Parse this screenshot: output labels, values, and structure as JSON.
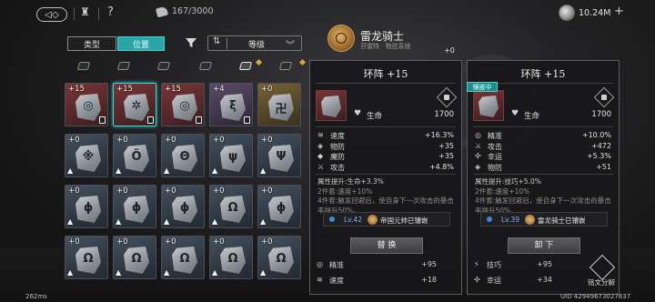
{
  "topbar": {
    "back_glyph": "◁◇",
    "help": "?",
    "bag_count": "167/3000",
    "currency": "10.24M",
    "plus": "+"
  },
  "filters": {
    "tab_type": "类型",
    "tab_position": "位置",
    "sort_label": "等级",
    "sort_arrows": "⇅",
    "chevron": "︾"
  },
  "hero": {
    "name": "雷龙骑士",
    "subtitle": "芬雷特 · 物控系统",
    "badge": "+0"
  },
  "grid": {
    "rows": [
      [
        {
          "lvl": "+15",
          "tone": "red",
          "glyph": "◎",
          "lock": true,
          "up": false
        },
        {
          "lvl": "+15",
          "tone": "red",
          "glyph": "✲",
          "lock": true,
          "up": false,
          "selected": true
        },
        {
          "lvl": "+15",
          "tone": "red",
          "glyph": "◎",
          "lock": true,
          "up": false
        },
        {
          "lvl": "+4",
          "tone": "purple",
          "glyph": "ξ",
          "lock": true,
          "up": false
        },
        {
          "lvl": "+0",
          "tone": "gold",
          "glyph": "卍",
          "lock": false,
          "up": false
        }
      ],
      [
        {
          "lvl": "+0",
          "tone": "blue",
          "glyph": "※",
          "lock": false,
          "up": true
        },
        {
          "lvl": "+0",
          "tone": "blue",
          "glyph": "Ö",
          "lock": false,
          "up": true
        },
        {
          "lvl": "+0",
          "tone": "blue",
          "glyph": "Θ",
          "lock": false,
          "up": true
        },
        {
          "lvl": "+0",
          "tone": "blue",
          "glyph": "ψ",
          "lock": false,
          "up": true
        },
        {
          "lvl": "+0",
          "tone": "blue",
          "glyph": "Ψ",
          "lock": false,
          "up": true
        }
      ],
      [
        {
          "lvl": "+0",
          "tone": "blue",
          "glyph": "ϕ",
          "lock": false,
          "up": true
        },
        {
          "lvl": "+0",
          "tone": "blue",
          "glyph": "ϕ",
          "lock": false,
          "up": true
        },
        {
          "lvl": "+0",
          "tone": "blue",
          "glyph": "ϕ",
          "lock": false,
          "up": true
        },
        {
          "lvl": "+0",
          "tone": "blue",
          "glyph": "Ω",
          "lock": false,
          "up": true
        },
        {
          "lvl": "+0",
          "tone": "blue",
          "glyph": "ϕ",
          "lock": false,
          "up": true
        }
      ],
      [
        {
          "lvl": "+0",
          "tone": "blue",
          "glyph": "Ω",
          "lock": false,
          "up": true
        },
        {
          "lvl": "+0",
          "tone": "blue",
          "glyph": "Ω",
          "lock": false,
          "up": true
        },
        {
          "lvl": "+0",
          "tone": "blue",
          "glyph": "Ω",
          "lock": false,
          "up": true
        },
        {
          "lvl": "+0",
          "tone": "blue",
          "glyph": "Ω",
          "lock": false,
          "up": true
        },
        {
          "lvl": "+0",
          "tone": "blue",
          "glyph": "Ω",
          "lock": false,
          "up": true
        }
      ]
    ]
  },
  "left_panel": {
    "title": "环阵 +15",
    "main_stat": {
      "label": "生命",
      "value": "1700"
    },
    "substats": [
      {
        "icon": "speed-icon",
        "glyph": "≋",
        "label": "速度",
        "value": "+16.3%"
      },
      {
        "icon": "shield-icon",
        "glyph": "◈",
        "label": "物防",
        "value": "+35"
      },
      {
        "icon": "magic-shield-icon",
        "glyph": "◆",
        "label": "魔防",
        "value": "+35"
      },
      {
        "icon": "attack-icon",
        "glyph": "⚔",
        "label": "攻击",
        "value": "+4.8%"
      }
    ],
    "set_title": "属性提升:生命+3.3%",
    "set_2": "2件套:速度+10%",
    "set_4": "4件套:触发回避后，使自身下一次攻击的暴击率提升50%。",
    "owner_level": "Lv.42",
    "owner_name": "帝国元帅已镶嵌",
    "button": "替 换"
  },
  "right_panel": {
    "title": "环阵 +15",
    "equipped_tag": "镶嵌中",
    "main_stat": {
      "label": "生命",
      "value": "1700"
    },
    "substats": [
      {
        "icon": "precision-icon",
        "glyph": "◎",
        "label": "精准",
        "value": "+10.0%"
      },
      {
        "icon": "attack-icon",
        "glyph": "⚔",
        "label": "攻击",
        "value": "+472"
      },
      {
        "icon": "luck-icon",
        "glyph": "✣",
        "label": "幸运",
        "value": "+5.3%"
      },
      {
        "icon": "shield-icon",
        "glyph": "◈",
        "label": "物防",
        "value": "+51"
      }
    ],
    "set_title": "属性提升:技巧+5.0%",
    "set_2": "2件套:速度+10%",
    "set_4": "4件套:触发回避后，使自身下一次攻击的暴击率提升50%。",
    "owner_level": "Lv.39",
    "owner_name": "雷龙骑士已镶嵌",
    "button": "卸 下"
  },
  "ghost_rows": [
    {
      "label": "精准",
      "value": "+95"
    },
    {
      "label": "技巧",
      "value": "+95"
    },
    {
      "label": "速度",
      "value": "+18"
    },
    {
      "label": "幸运",
      "value": "+34"
    }
  ],
  "bottom": {
    "fps": "262ms",
    "uid": "UID 42949673027837",
    "dismantle": "铭文分解"
  }
}
